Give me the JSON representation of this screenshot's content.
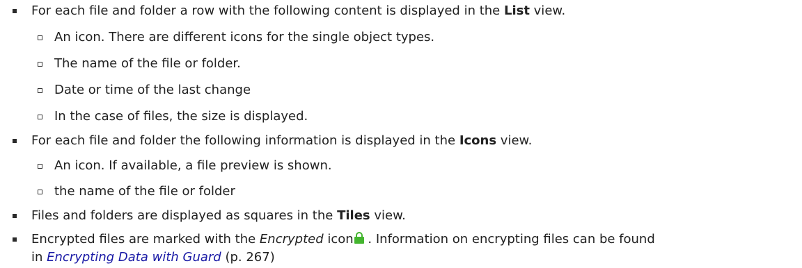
{
  "items": [
    {
      "pre": "For each file and folder a row with the following content is displayed in the ",
      "bold": "List",
      "post": " view."
    },
    {
      "text": "An icon. There are different icons for the single object types."
    },
    {
      "text": "The name of the file or folder."
    },
    {
      "text": "Date or time of the last change"
    },
    {
      "text": "In the case of files, the size is displayed."
    },
    {
      "pre": "For each file and folder the following information is displayed in the ",
      "bold": "Icons",
      "post": " view."
    },
    {
      "text": "An icon. If available, a file preview is shown."
    },
    {
      "text": "the name of the file or folder"
    },
    {
      "pre": "Files and folders are displayed as squares in the ",
      "bold": "Tiles",
      "post": " view."
    },
    {
      "pre": "Encrypted files are marked with the ",
      "em": "Encrypted",
      "mid": " icon",
      "icon": "lock-icon",
      "post": " . Information on encrypting files can be found",
      "cont_pre": "in ",
      "link": "Encrypting Data with Guard",
      "cont_post": " (p. 267)"
    }
  ],
  "colors": {
    "text": "#222222",
    "link": "#1a1aa6",
    "lock_icon": "#44b52f"
  }
}
